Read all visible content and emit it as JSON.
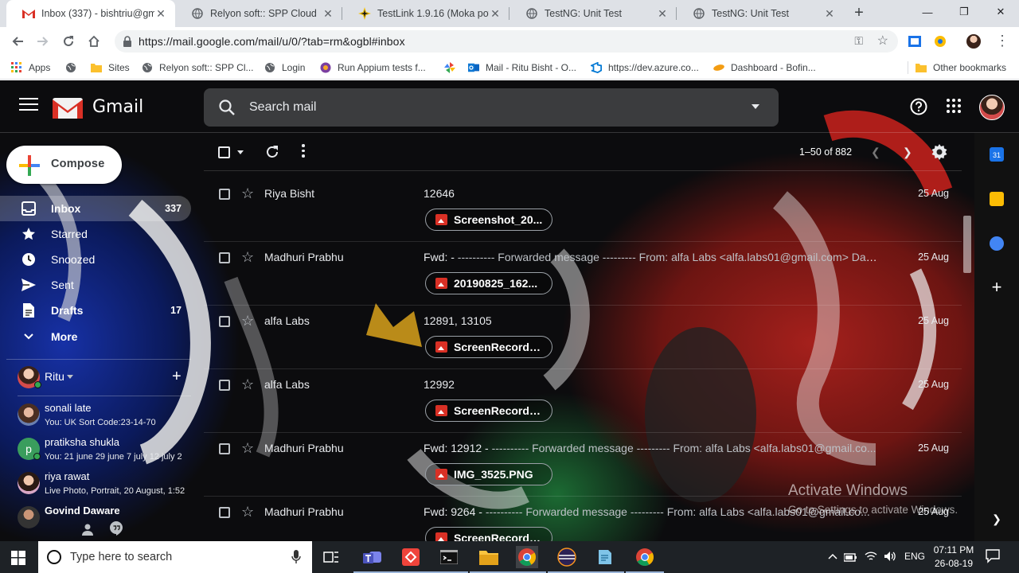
{
  "browser": {
    "tabs": [
      {
        "title": "Inbox (337) - bishtriu@gma",
        "icon": "gmail-icon",
        "active": true
      },
      {
        "title": "Relyon soft:: SPP Cloud",
        "icon": "globe-icon",
        "active": false
      },
      {
        "title": "TestLink 1.9.16 (Moka pot)",
        "icon": "testlink-icon",
        "active": false
      },
      {
        "title": "TestNG: Unit Test",
        "icon": "globe-icon",
        "active": false
      },
      {
        "title": "TestNG: Unit Test",
        "icon": "globe-icon",
        "active": false
      }
    ],
    "url": "https://mail.google.com/mail/u/0/?tab=rm&ogbl#inbox",
    "bookmarks": [
      {
        "label": "Apps",
        "icon": "apps-grid-icon"
      },
      {
        "label": "",
        "icon": "globe-icon"
      },
      {
        "label": "Sites",
        "icon": "folder-icon"
      },
      {
        "label": "Relyon soft:: SPP Cl...",
        "icon": "globe-icon"
      },
      {
        "label": "Login",
        "icon": "globe-icon"
      },
      {
        "label": "Run Appium tests f...",
        "icon": "appium-icon"
      },
      {
        "label": "",
        "icon": "pinwheel-icon"
      },
      {
        "label": "Mail - Ritu Bisht - O...",
        "icon": "outlook-icon"
      },
      {
        "label": "https://dev.azure.co...",
        "icon": "azure-icon"
      },
      {
        "label": "Dashboard - Bofin...",
        "icon": "bofin-icon"
      }
    ],
    "other_bookmarks": "Other bookmarks"
  },
  "gmail": {
    "product_name": "Gmail",
    "search_placeholder": "Search mail",
    "compose_label": "Compose",
    "nav": [
      {
        "label": "Inbox",
        "count": "337",
        "icon": "inbox-icon",
        "active": true,
        "bold": true
      },
      {
        "label": "Starred",
        "count": "",
        "icon": "star-icon",
        "active": false,
        "bold": false
      },
      {
        "label": "Snoozed",
        "count": "",
        "icon": "clock-icon",
        "active": false,
        "bold": false
      },
      {
        "label": "Sent",
        "count": "",
        "icon": "send-icon",
        "active": false,
        "bold": false
      },
      {
        "label": "Drafts",
        "count": "17",
        "icon": "draft-icon",
        "active": false,
        "bold": true
      },
      {
        "label": "More",
        "count": "",
        "icon": "chevron-down-icon",
        "active": false,
        "bold": false
      }
    ],
    "hangouts": {
      "user": "Ritu",
      "contacts": [
        {
          "name": "sonali late",
          "status": "You: UK Sort Code:23-14-70",
          "initial": ""
        },
        {
          "name": "pratiksha shukla",
          "status": "You: 21 june  29 june 7 july 12 july 2",
          "initial": "p"
        },
        {
          "name": "riya rawat",
          "status": "Live Photo, Portrait, 20 August, 1:52",
          "initial": ""
        },
        {
          "name": "Govind Daware",
          "status": "",
          "initial": ""
        }
      ]
    },
    "pagination": "1–50 of 882",
    "emails": [
      {
        "sender": "Riya Bisht",
        "subject": "12646",
        "snippet": "",
        "date": "25 Aug",
        "attachment": "Screenshot_20...",
        "att_type": "image"
      },
      {
        "sender": "Madhuri Prabhu",
        "subject": "Fwd: -",
        "snippet": " ---------- Forwarded message --------- From: alfa Labs <alfa.labs01@gmail.com> Dat...",
        "date": "25 Aug",
        "attachment": "20190825_162...",
        "att_type": "video"
      },
      {
        "sender": "alfa Labs",
        "subject": "12891, 13105",
        "snippet": "",
        "date": "25 Aug",
        "attachment": "ScreenRecordin...",
        "att_type": "video"
      },
      {
        "sender": "alfa Labs",
        "subject": "12992",
        "snippet": "",
        "date": "25 Aug",
        "attachment": "ScreenRecordin...",
        "att_type": "video"
      },
      {
        "sender": "Madhuri Prabhu",
        "subject": "Fwd: 12912 -",
        "snippet": " ---------- Forwarded message --------- From: alfa Labs <alfa.labs01@gmail.co...",
        "date": "25 Aug",
        "attachment": "IMG_3525.PNG",
        "att_type": "image"
      },
      {
        "sender": "Madhuri Prabhu",
        "subject": "Fwd: 9264 -",
        "snippet": " ---------- Forwarded message --------- From: alfa Labs <alfa.labs01@gmail.co...",
        "date": "25 Aug",
        "attachment": "ScreenRecordin...",
        "att_type": "video"
      }
    ],
    "watermark": {
      "title": "Activate Windows",
      "subtitle": "Go to Settings to activate Windows."
    }
  },
  "taskbar": {
    "search_placeholder": "Type here to search",
    "language": "ENG",
    "time": "07:11 PM",
    "date": "26-08-19"
  },
  "colors": {
    "gmail_red": "#d93025",
    "chrome_tab_bg": "#dee1e6",
    "taskbar_bg": "#1e2226"
  }
}
